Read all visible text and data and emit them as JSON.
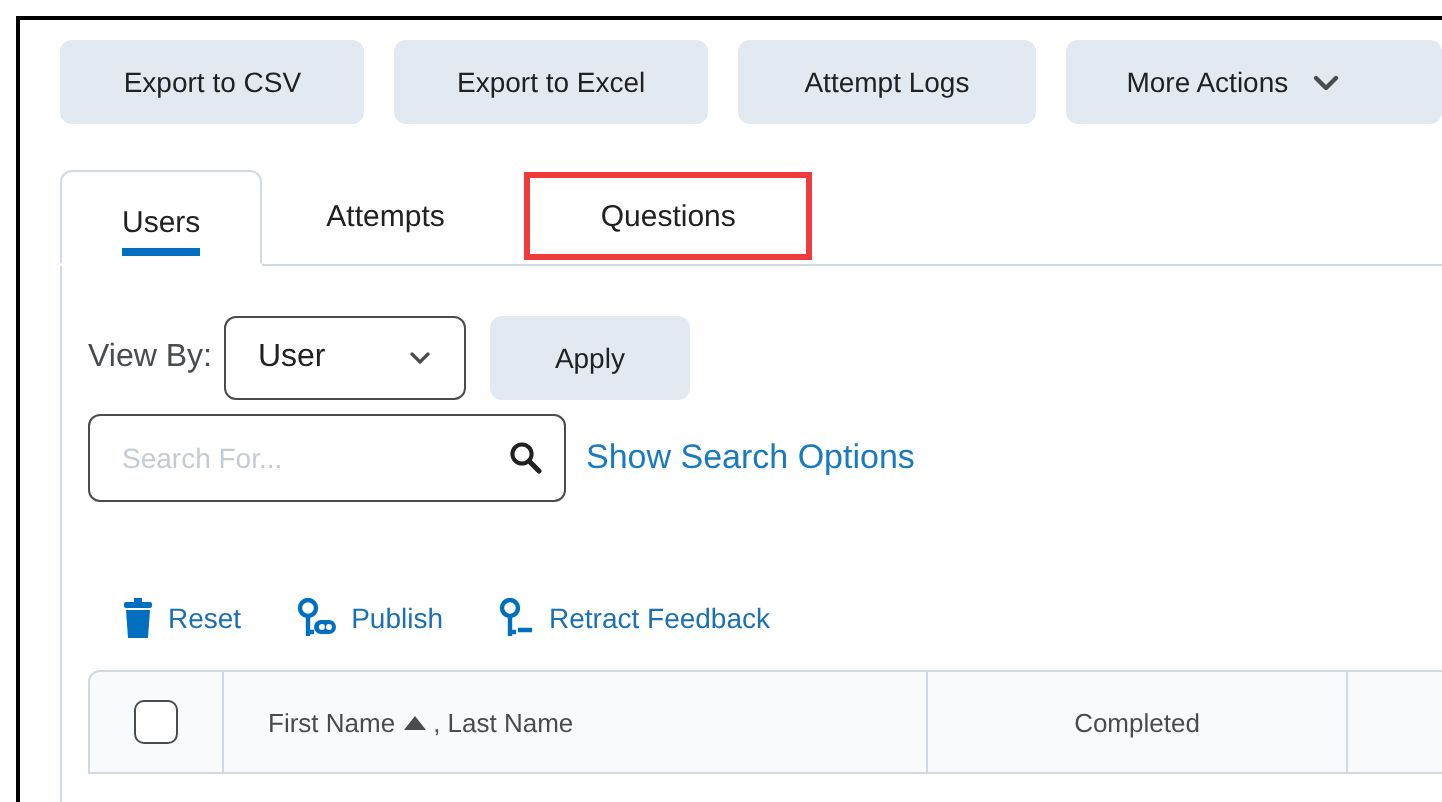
{
  "toolbar": {
    "buttons": [
      {
        "label": "Export to CSV",
        "kind": "plain"
      },
      {
        "label": "Export to Excel",
        "kind": "plain"
      },
      {
        "label": "Attempt Logs",
        "kind": "plain"
      },
      {
        "label": "More Actions",
        "kind": "menu"
      }
    ]
  },
  "tabs": [
    {
      "label": "Users",
      "selected": true,
      "highlighted": false
    },
    {
      "label": "Attempts",
      "selected": false,
      "highlighted": false
    },
    {
      "label": "Questions",
      "selected": false,
      "highlighted": true
    }
  ],
  "view_by": {
    "label": "View By:",
    "value": "User",
    "apply": "Apply"
  },
  "search": {
    "placeholder": "Search For...",
    "options_link": "Show Search Options"
  },
  "actions": [
    {
      "label": "Reset",
      "kind": "trash"
    },
    {
      "label": "Publish",
      "kind": "publish"
    },
    {
      "label": "Retract Feedback",
      "kind": "retract"
    }
  ],
  "table": {
    "select_all": {
      "checked": false
    },
    "columns": [
      {
        "label": "First Name",
        "sorted": true,
        "suffix": ", Last Name"
      },
      {
        "label": "Completed",
        "sorted": false
      }
    ]
  }
}
